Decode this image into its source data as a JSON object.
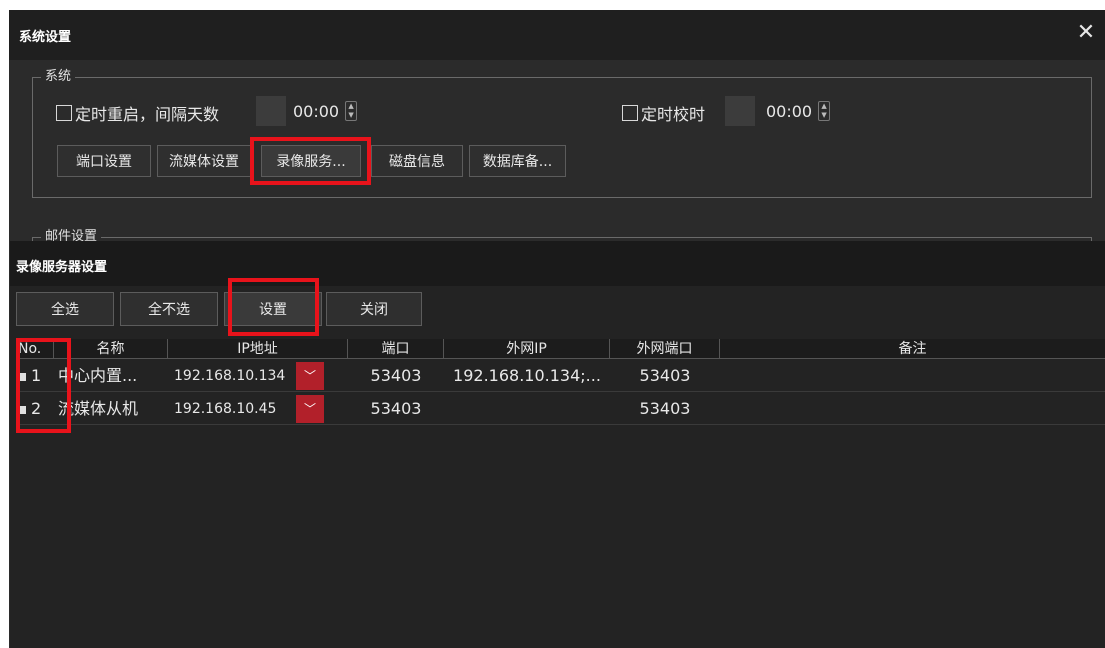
{
  "sys_dialog": {
    "title": "系统设置",
    "close_glyph": "✕",
    "system_group": {
      "legend": "系统",
      "reboot_label": "定时重启，间隔天数",
      "reboot_time": "00:00",
      "timesync_label": "定时校时",
      "timesync_time": "00:00",
      "buttons": [
        "端口设置",
        "流媒体设置",
        "录像服务...",
        "磁盘信息",
        "数据库备..."
      ]
    },
    "mail_group": {
      "legend": "邮件设置"
    }
  },
  "rec_dialog": {
    "title": "录像服务器设置",
    "toolbar": [
      "全选",
      "全不选",
      "设置",
      "关闭"
    ],
    "columns": [
      "No.",
      "名称",
      "IP地址",
      "端口",
      "外网IP",
      "外网端口",
      "备注"
    ],
    "rows": [
      {
        "no": "1",
        "name": "中心内置...",
        "ip": "192.168.10.134",
        "port": "53403",
        "ext_ip": "192.168.10.134;...",
        "ext_port": "53403",
        "note": ""
      },
      {
        "no": "2",
        "name": "流媒体从机",
        "ip": "192.168.10.45",
        "port": "53403",
        "ext_ip": "",
        "ext_port": "53403",
        "note": ""
      }
    ]
  },
  "icons": {
    "dropdown": "chevron-down-icon",
    "spinner": "spinner-arrows-icon",
    "close": "close-icon"
  },
  "colors": {
    "highlight_red": "#e8131b",
    "dropdown_red": "#b2202a",
    "dialog_bg": "#2b2b2b",
    "titlebar_bg": "#1f1f1f"
  }
}
